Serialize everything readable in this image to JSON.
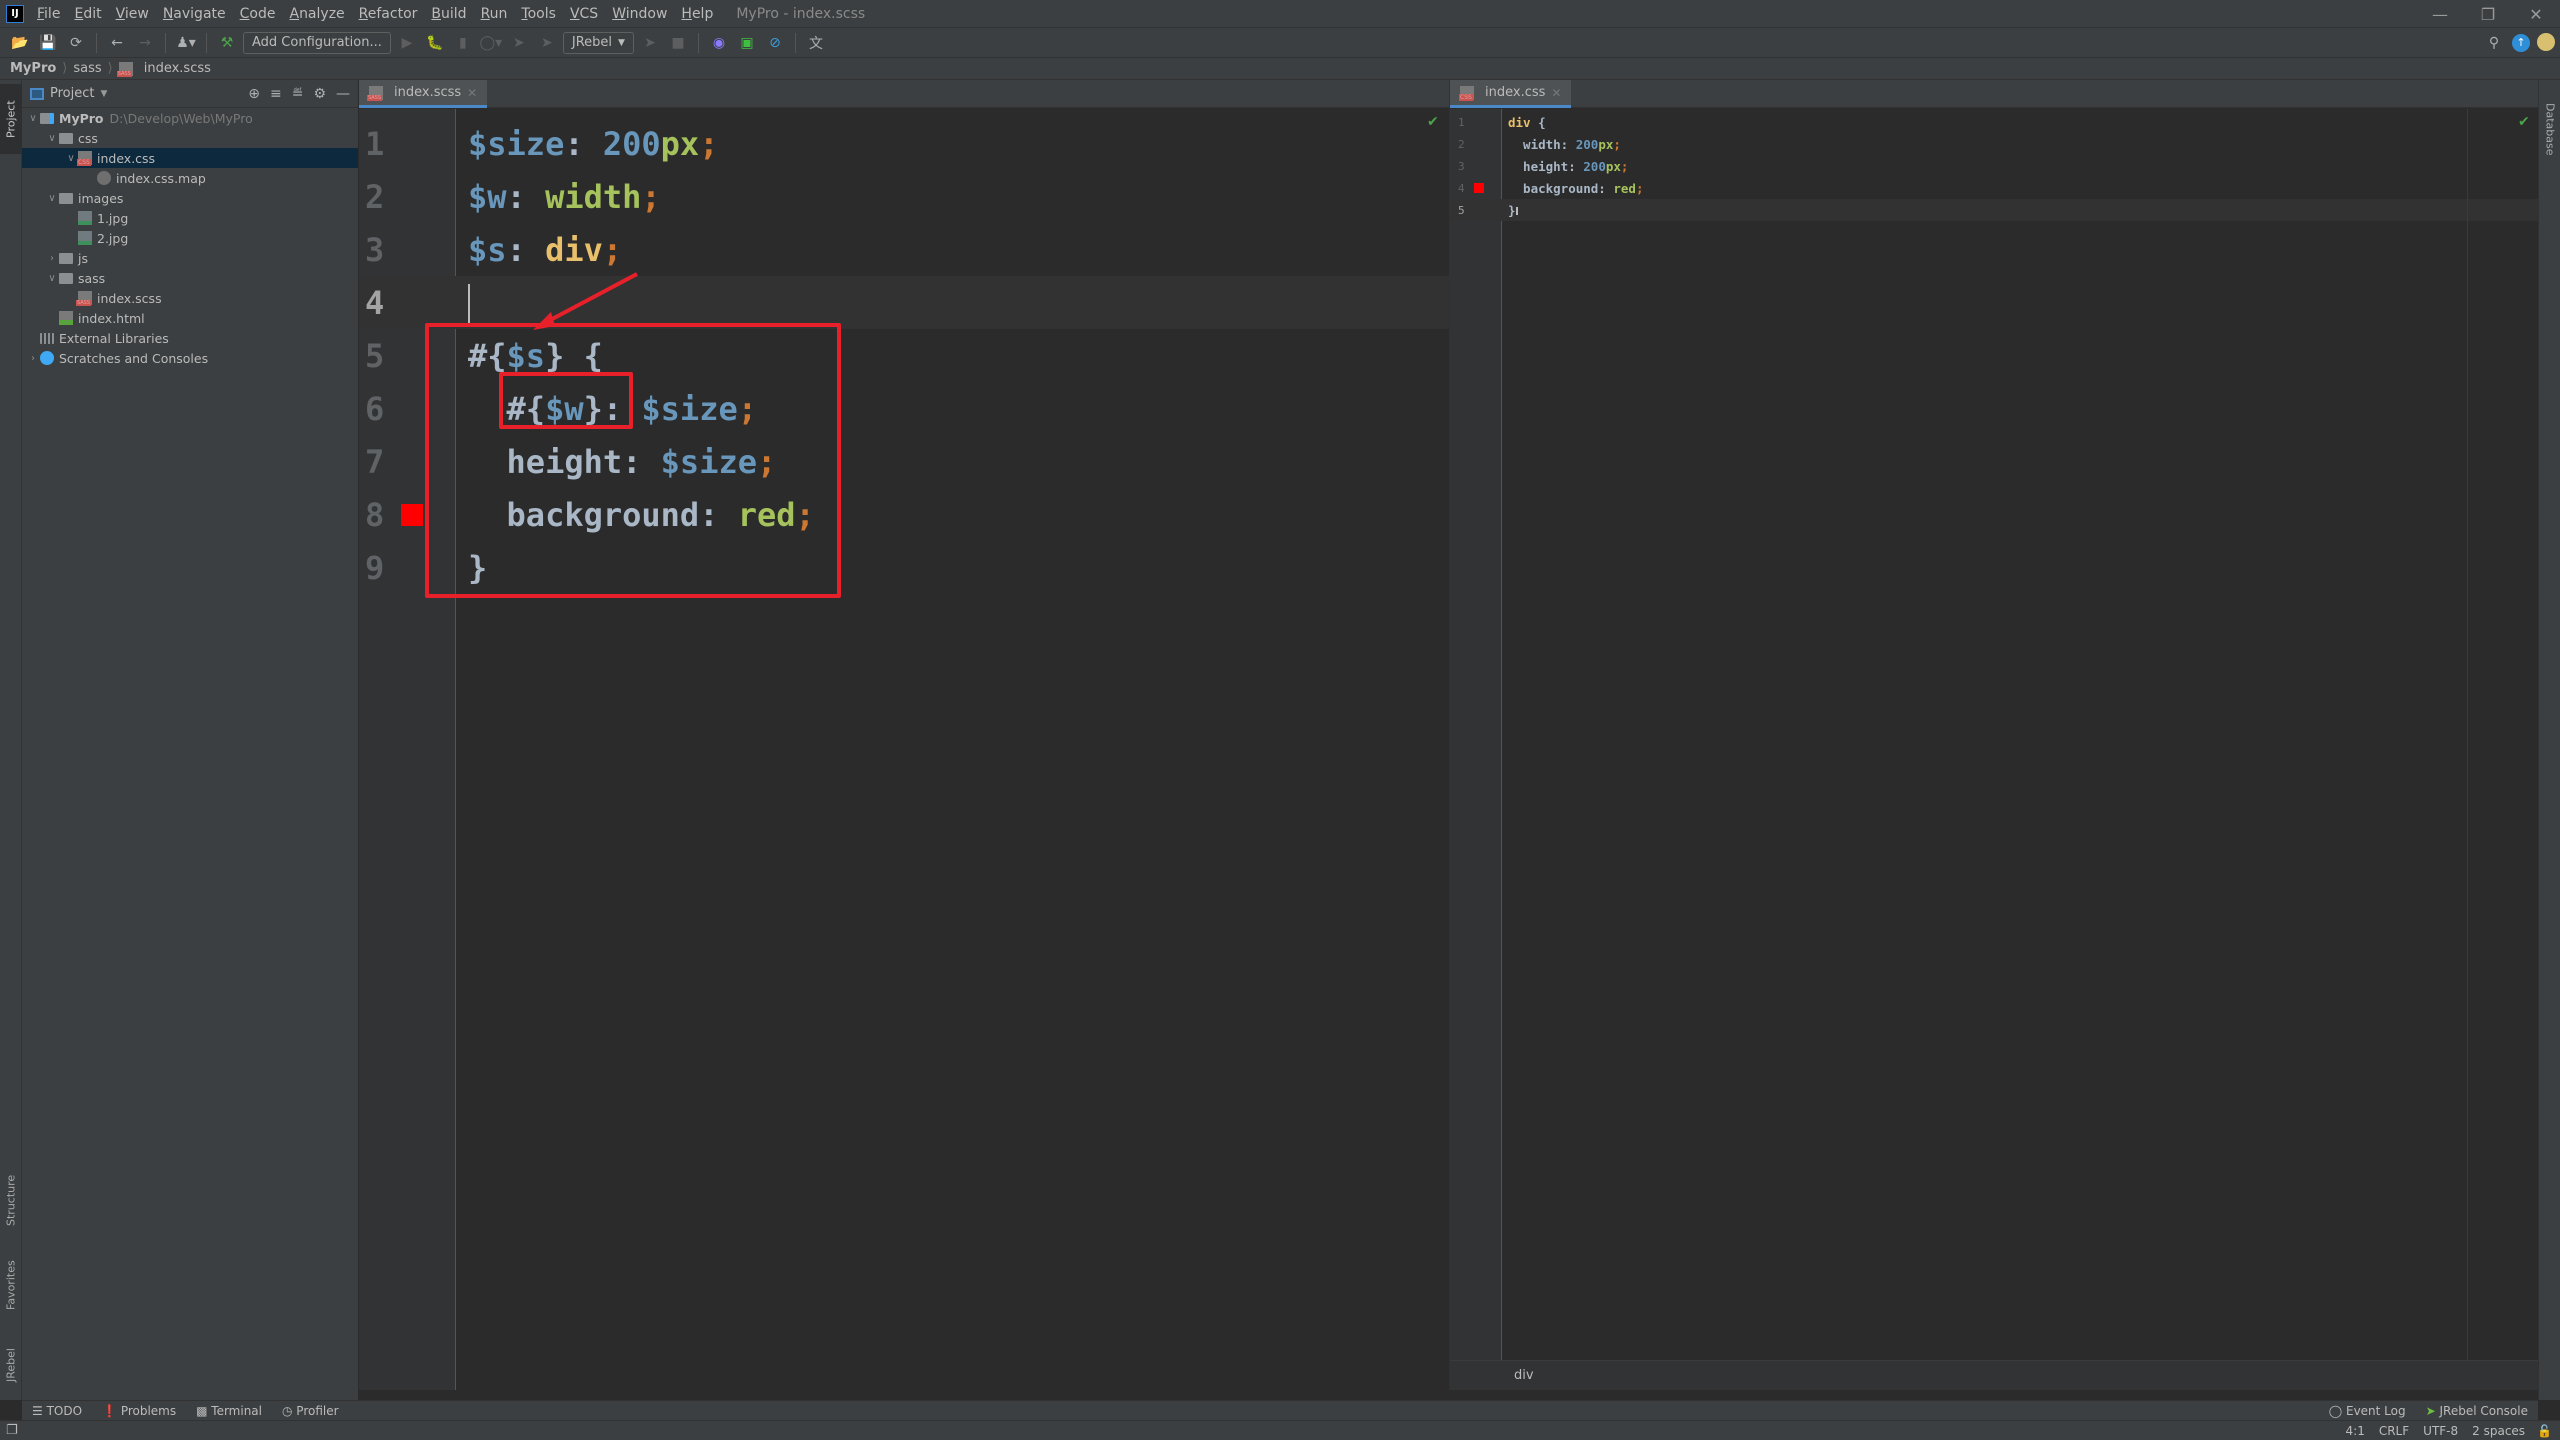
{
  "app": {
    "window_title": "MyPro - index.scss",
    "menu": [
      "File",
      "Edit",
      "View",
      "Navigate",
      "Code",
      "Analyze",
      "Refactor",
      "Build",
      "Run",
      "Tools",
      "VCS",
      "Window",
      "Help"
    ]
  },
  "toolbar": {
    "add_configuration": "Add Configuration...",
    "jrebel_combo": "JRebel"
  },
  "breadcrumb": [
    "MyPro",
    "sass",
    "index.scss"
  ],
  "side_tabs": {
    "left": [
      "Project",
      "Structure",
      "Favorites",
      "JRebel"
    ],
    "right": [
      "Database"
    ]
  },
  "project": {
    "header": "Project",
    "tree": [
      {
        "label": "MyPro",
        "path": "D:\\Develop\\Web\\MyPro",
        "icon": "module-folder",
        "depth": 0,
        "expanded": true,
        "bold": true
      },
      {
        "label": "css",
        "icon": "folder",
        "depth": 1,
        "expanded": true
      },
      {
        "label": "index.css",
        "icon": "css-file",
        "depth": 2,
        "expanded": true,
        "selected": true
      },
      {
        "label": "index.css.map",
        "icon": "map-file",
        "depth": 3
      },
      {
        "label": "images",
        "icon": "folder",
        "depth": 1,
        "expanded": true
      },
      {
        "label": "1.jpg",
        "icon": "image-file",
        "depth": 2
      },
      {
        "label": "2.jpg",
        "icon": "image-file",
        "depth": 2
      },
      {
        "label": "js",
        "icon": "folder",
        "depth": 1,
        "expanded": false
      },
      {
        "label": "sass",
        "icon": "folder",
        "depth": 1,
        "expanded": true
      },
      {
        "label": "index.scss",
        "icon": "sass-file",
        "depth": 2
      },
      {
        "label": "index.html",
        "icon": "html-file",
        "depth": 1
      },
      {
        "label": "External Libraries",
        "icon": "libraries",
        "depth": 0
      },
      {
        "label": "Scratches and Consoles",
        "icon": "scratches",
        "depth": 0,
        "expanded": false
      }
    ]
  },
  "editor_left": {
    "tab": "index.scss",
    "lines": [
      {
        "n": "1",
        "tokens": [
          [
            "$size",
            "var"
          ],
          [
            ": ",
            "plain"
          ],
          [
            "200",
            "num"
          ],
          [
            "px",
            "unit"
          ],
          [
            ";",
            "semi"
          ]
        ]
      },
      {
        "n": "2",
        "tokens": [
          [
            "$w",
            "var"
          ],
          [
            ": ",
            "plain"
          ],
          [
            "width",
            "kw"
          ],
          [
            ";",
            "semi"
          ]
        ]
      },
      {
        "n": "3",
        "tokens": [
          [
            "$s",
            "var"
          ],
          [
            ": ",
            "plain"
          ],
          [
            "div",
            "tag"
          ],
          [
            ";",
            "semi"
          ]
        ]
      },
      {
        "n": "4",
        "tokens": []
      },
      {
        "n": "5",
        "tokens": [
          [
            "#{",
            "plain"
          ],
          [
            "$s",
            "var"
          ],
          [
            "} {",
            "plain"
          ]
        ]
      },
      {
        "n": "6",
        "tokens": [
          [
            "  #{",
            "plain"
          ],
          [
            "$w",
            "var"
          ],
          [
            "}: ",
            "plain"
          ],
          [
            "$size",
            "var"
          ],
          [
            ";",
            "semi"
          ]
        ]
      },
      {
        "n": "7",
        "tokens": [
          [
            "  height: ",
            "plain"
          ],
          [
            "$size",
            "var"
          ],
          [
            ";",
            "semi"
          ]
        ]
      },
      {
        "n": "8",
        "tokens": [
          [
            "  background: ",
            "plain"
          ],
          [
            "red",
            "kw"
          ],
          [
            ";",
            "semi"
          ]
        ]
      },
      {
        "n": "9",
        "tokens": [
          [
            "}",
            "plain"
          ]
        ]
      }
    ]
  },
  "editor_right": {
    "tab": "index.css",
    "lines": [
      {
        "n": "1",
        "tokens": [
          [
            "div",
            "tag"
          ],
          [
            " {",
            "plain"
          ]
        ]
      },
      {
        "n": "2",
        "tokens": [
          [
            "  width: ",
            "plain"
          ],
          [
            "200",
            "num"
          ],
          [
            "px",
            "unit"
          ],
          [
            ";",
            "semi"
          ]
        ]
      },
      {
        "n": "3",
        "tokens": [
          [
            "  height: ",
            "plain"
          ],
          [
            "200",
            "num"
          ],
          [
            "px",
            "unit"
          ],
          [
            ";",
            "semi"
          ]
        ]
      },
      {
        "n": "4",
        "tokens": [
          [
            "  background: ",
            "plain"
          ],
          [
            "red",
            "kw"
          ],
          [
            ";",
            "semi"
          ]
        ]
      },
      {
        "n": "5",
        "tokens": [
          [
            "}",
            "plain"
          ]
        ]
      }
    ],
    "breadcrumb": "div"
  },
  "bottom_tools": [
    "TODO",
    "Problems",
    "Terminal",
    "Profiler"
  ],
  "bottom_right_tools": [
    "Event Log",
    "JRebel Console"
  ],
  "status": {
    "position": "4:1",
    "line_sep": "CRLF",
    "encoding": "UTF-8",
    "indent": "2 spaces"
  },
  "colors": {
    "annotation": "#e8202a",
    "color_swatch": "#ff0000"
  }
}
